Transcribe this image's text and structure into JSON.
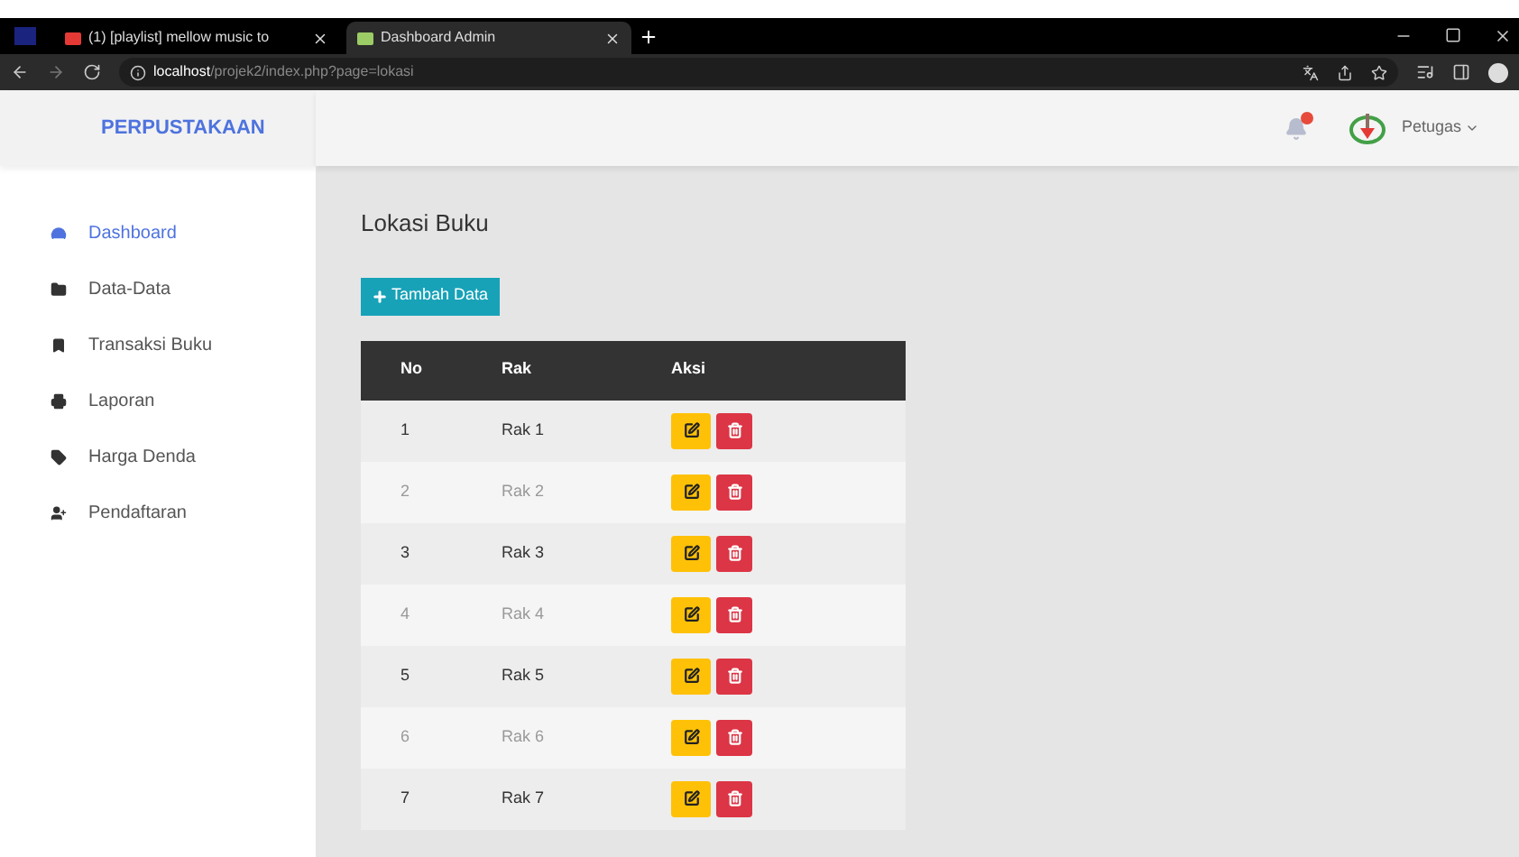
{
  "browser": {
    "tabs": [
      {
        "title": "(1) [playlist] mellow music to",
        "selected": false
      },
      {
        "title": "Dashboard Admin",
        "selected": true
      }
    ],
    "url_host": "localhost",
    "url_path": "/projek2/index.php?page=lokasi"
  },
  "brand": "PERPUSTAKAAN",
  "user": {
    "name": "Petugas"
  },
  "sidebar": {
    "items": [
      {
        "label": "Dashboard",
        "selected": true
      },
      {
        "label": "Data-Data",
        "selected": false
      },
      {
        "label": "Transaksi Buku",
        "selected": false
      },
      {
        "label": "Laporan",
        "selected": false
      },
      {
        "label": "Harga Denda",
        "selected": false
      },
      {
        "label": "Pendaftaran",
        "selected": false
      }
    ]
  },
  "page_title": "Lokasi Buku",
  "add_button": "Tambah Data",
  "table": {
    "columns": [
      "No",
      "Rak",
      "Aksi"
    ],
    "rows": [
      [
        "1",
        "Rak 1"
      ],
      [
        "2",
        "Rak 2"
      ],
      [
        "3",
        "Rak 3"
      ],
      [
        "4",
        "Rak 4"
      ],
      [
        "5",
        "Rak 5"
      ],
      [
        "6",
        "Rak 6"
      ],
      [
        "7",
        "Rak 7"
      ]
    ]
  }
}
